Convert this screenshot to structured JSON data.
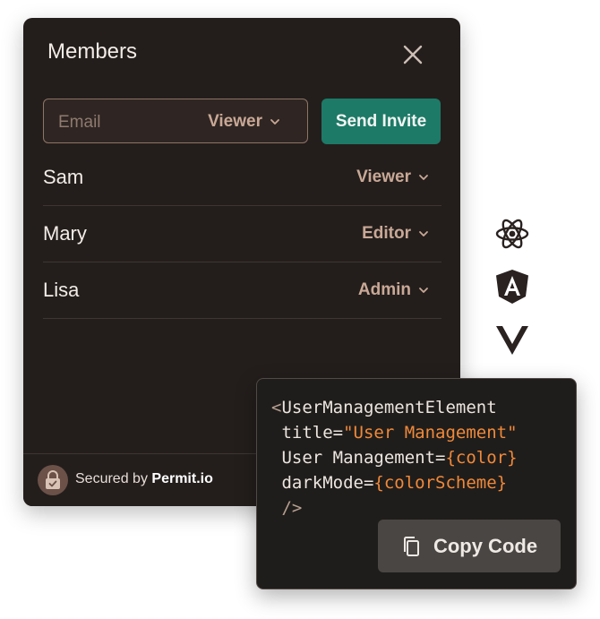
{
  "panel": {
    "title": "Members",
    "invite": {
      "email_placeholder": "Email",
      "selected_role": "Viewer",
      "send_label": "Send Invite"
    },
    "members": [
      {
        "name": "Sam",
        "role": "Viewer"
      },
      {
        "name": "Mary",
        "role": "Editor"
      },
      {
        "name": "Lisa",
        "role": "Admin"
      }
    ],
    "footer": {
      "prefix": "Secured by ",
      "brand": "Permit.io"
    }
  },
  "frameworks": [
    "react-icon",
    "angular-icon",
    "vue-icon"
  ],
  "code": {
    "open": "<",
    "line1_tag": "UserManagementElement",
    "line2_attr": " title=",
    "line2_val": "\"User Management\"",
    "line3_attr": " User Management=",
    "line3_val": "{color}",
    "line4_attr": " darkMode=",
    "line4_val": "{colorScheme}",
    "close": " />"
  },
  "copy_button": {
    "label": "Copy Code"
  },
  "colors": {
    "panel_bg": "#231e1c",
    "accent_green": "#1d7a67",
    "role_text": "#c9a896",
    "code_string": "#f0893a"
  }
}
